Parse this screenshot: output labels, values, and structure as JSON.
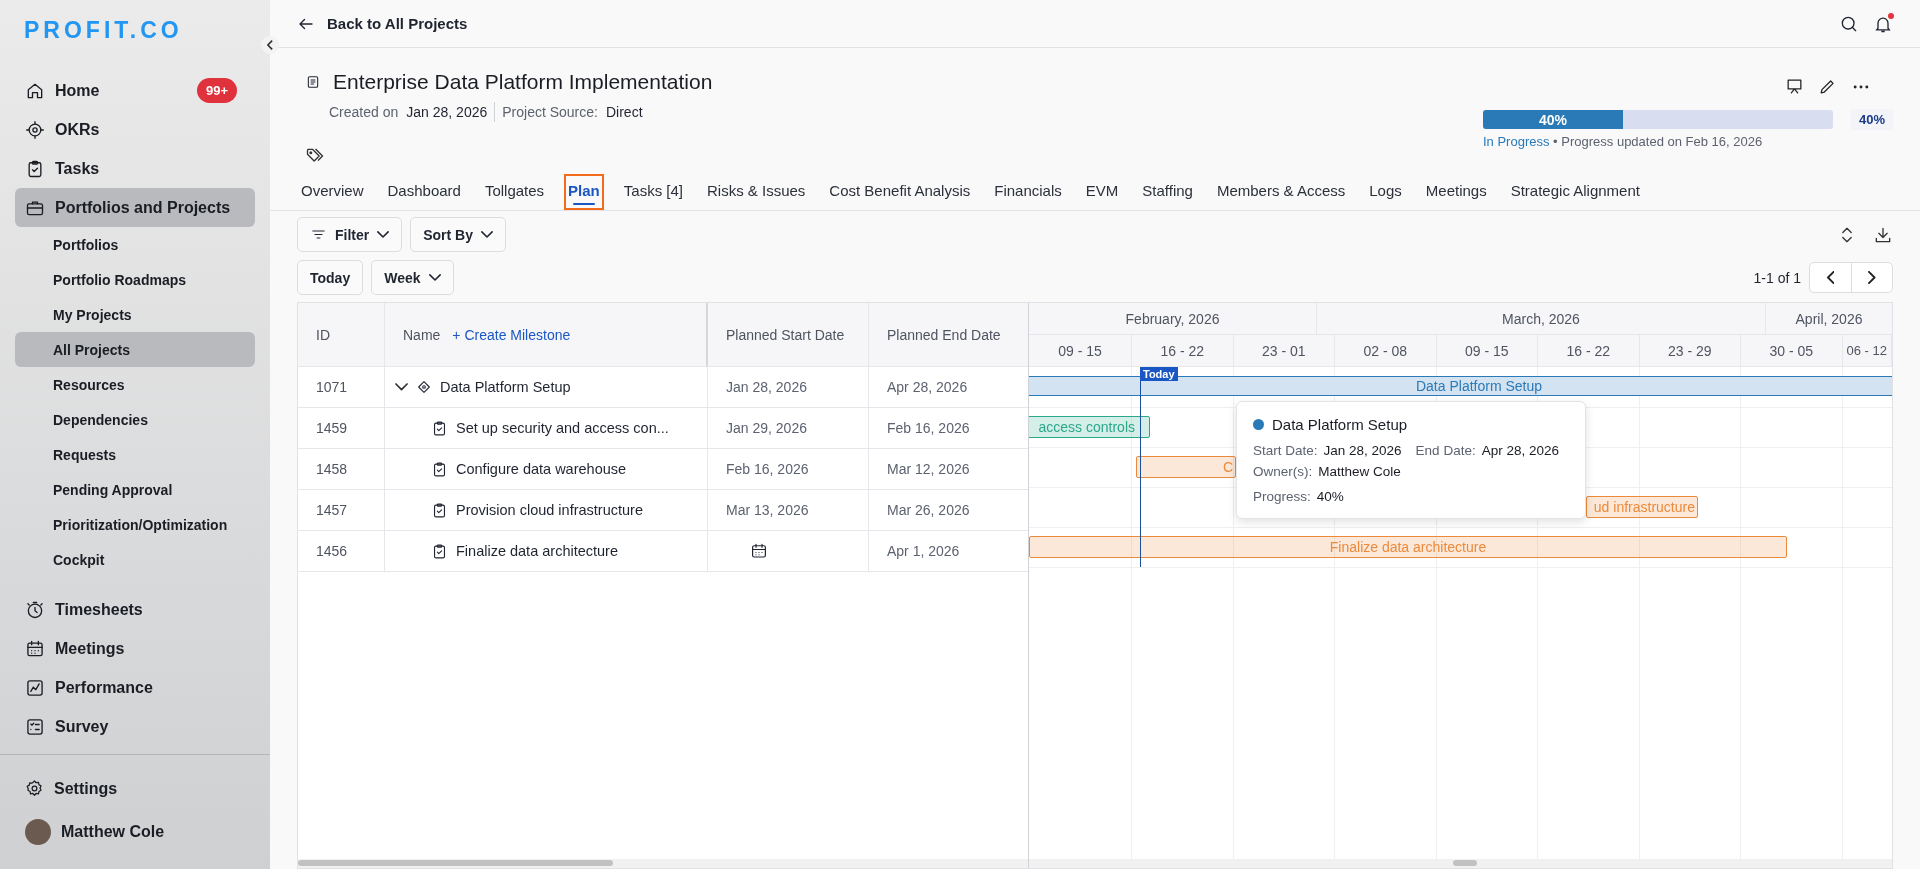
{
  "sidebar": {
    "logo": "PROFIT.CO",
    "items": [
      {
        "label": "Home",
        "badge": "99+",
        "selected": false
      },
      {
        "label": "OKRs",
        "selected": false
      },
      {
        "label": "Tasks",
        "selected": false
      },
      {
        "label": "Portfolios and Projects",
        "selected": true,
        "children": [
          {
            "label": "Portfolios",
            "selected": false
          },
          {
            "label": "Portfolio Roadmaps",
            "selected": false
          },
          {
            "label": "My Projects",
            "selected": false
          },
          {
            "label": "All Projects",
            "selected": true
          },
          {
            "label": "Resources",
            "selected": false
          },
          {
            "label": "Dependencies",
            "selected": false
          },
          {
            "label": "Requests",
            "selected": false
          },
          {
            "label": "Pending Approval",
            "selected": false
          },
          {
            "label": "Prioritization/Optimization",
            "selected": false
          },
          {
            "label": "Cockpit",
            "selected": false
          }
        ]
      },
      {
        "label": "Timesheets",
        "selected": false
      },
      {
        "label": "Meetings",
        "selected": false
      },
      {
        "label": "Performance",
        "selected": false
      },
      {
        "label": "Survey",
        "selected": false
      }
    ],
    "settings": "Settings",
    "user": "Matthew Cole"
  },
  "top_bar": {
    "back_link": "Back to All Projects"
  },
  "project": {
    "title": "Enterprise Data Platform Implementation",
    "created_label": "Created on",
    "created_date": "Jan 28, 2026",
    "source_label": "Project Source:",
    "source": "Direct",
    "progress": {
      "level": 0.4,
      "bar_label": "40%",
      "reading": "40%",
      "status": "In Progress",
      "updated": "• Progress updated on Feb 16, 2026"
    }
  },
  "tabs": [
    {
      "label": "Overview",
      "selected": false
    },
    {
      "label": "Dashboard",
      "selected": false
    },
    {
      "label": "Tollgates",
      "selected": false
    },
    {
      "label": "Plan",
      "selected": true
    },
    {
      "label": "Tasks [4]",
      "selected": false
    },
    {
      "label": "Risks & Issues",
      "selected": false
    },
    {
      "label": "Cost Benefit Analysis",
      "selected": false
    },
    {
      "label": "Financials",
      "selected": false
    },
    {
      "label": "EVM",
      "selected": false
    },
    {
      "label": "Staffing",
      "selected": false
    },
    {
      "label": "Members & Access",
      "selected": false
    },
    {
      "label": "Logs",
      "selected": false
    },
    {
      "label": "Meetings",
      "selected": false
    },
    {
      "label": "Strategic Alignment",
      "selected": false
    }
  ],
  "toolbar": {
    "filter": "Filter",
    "sort": "Sort By",
    "today": "Today",
    "scale": "Week",
    "pagination": "1-1 of 1"
  },
  "table": {
    "columns": [
      "ID",
      "Name",
      "Planned Start Date",
      "Planned End Date"
    ],
    "create_milestone": "+ Create Milestone",
    "rows": [
      {
        "id": "1071",
        "name": "Data Platform Setup",
        "kind": "milestone",
        "expanded": true,
        "start": "Jan 28, 2026",
        "end": "Apr 28, 2026",
        "children": [
          {
            "id": "1459",
            "name": "Set up security and access con...",
            "kind": "task",
            "start": "Jan 29, 2026",
            "end": "Feb 16, 2026"
          },
          {
            "id": "1458",
            "name": "Configure data warehouse",
            "kind": "task",
            "start": "Feb 16, 2026",
            "end": "Mar 12, 2026"
          },
          {
            "id": "1457",
            "name": "Provision cloud infrastructure",
            "kind": "task",
            "start": "Mar 13, 2026",
            "end": "Mar 26, 2026"
          },
          {
            "id": "1456",
            "name": "Finalize data architecture",
            "kind": "task",
            "end": "Apr 1, 2026"
          }
        ]
      }
    ]
  },
  "gantt": {
    "months": [
      "February, 2026",
      "March, 2026",
      "April, 2026"
    ],
    "weeks": [
      "09 - 15",
      "16 - 22",
      "23 - 01",
      "02 - 08",
      "09 - 15",
      "16 - 22",
      "23 - 29",
      "30 - 05",
      "06 - 12"
    ],
    "today_label": "Today",
    "bars": [
      {
        "label": "Data Platform Setup",
        "kind": "summary",
        "color": "#2a7ab8"
      },
      {
        "label": "access controls",
        "kind": "task",
        "color": "#2aa88a"
      },
      {
        "label": "C",
        "kind": "task",
        "color": "#ec8a3c"
      },
      {
        "label": "ud infrastructure",
        "kind": "task",
        "color": "#ec8a3c"
      },
      {
        "label": "Finalize data architecture",
        "kind": "task",
        "color": "#ec8a3c"
      }
    ],
    "tooltip": {
      "title": "Data Platform Setup",
      "start_label": "Start Date:",
      "start": "Jan 28, 2026",
      "end_label": "End Date:",
      "end": "Apr 28, 2026",
      "owner_label": "Owner(s):",
      "owner": "Matthew Cole",
      "progress_label": "Progress:",
      "progress": "40%"
    }
  }
}
